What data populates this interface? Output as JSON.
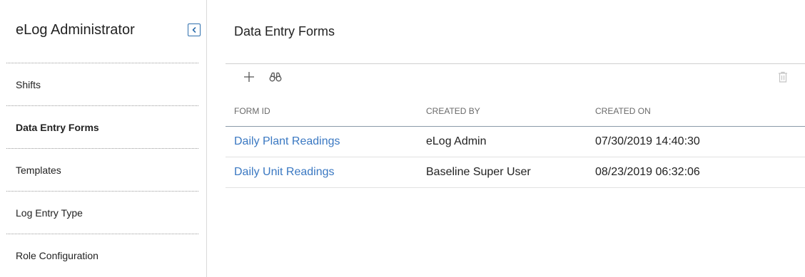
{
  "sidebar": {
    "title": "eLog Administrator",
    "items": [
      {
        "label": "Shifts",
        "active": false
      },
      {
        "label": "Data Entry Forms",
        "active": true
      },
      {
        "label": "Templates",
        "active": false
      },
      {
        "label": "Log Entry Type",
        "active": false
      },
      {
        "label": "Role Configuration",
        "active": false
      }
    ]
  },
  "main": {
    "title": "Data Entry Forms",
    "toolbar": {
      "icons": [
        "plus-icon",
        "binoculars-icon",
        "trash-icon"
      ]
    },
    "table": {
      "columns": [
        "FORM ID",
        "CREATED BY",
        "CREATED ON"
      ],
      "rows": [
        [
          "Daily Plant Readings",
          "eLog Admin",
          "07/30/2019 14:40:30"
        ],
        [
          "Daily Unit Readings",
          "Baseline Super User",
          "08/23/2019 06:32:06"
        ]
      ]
    }
  },
  "colors": {
    "accent": "#2f6fad",
    "link": "#3a78c2",
    "text": "#222222",
    "muted": "#6a6a6a"
  }
}
